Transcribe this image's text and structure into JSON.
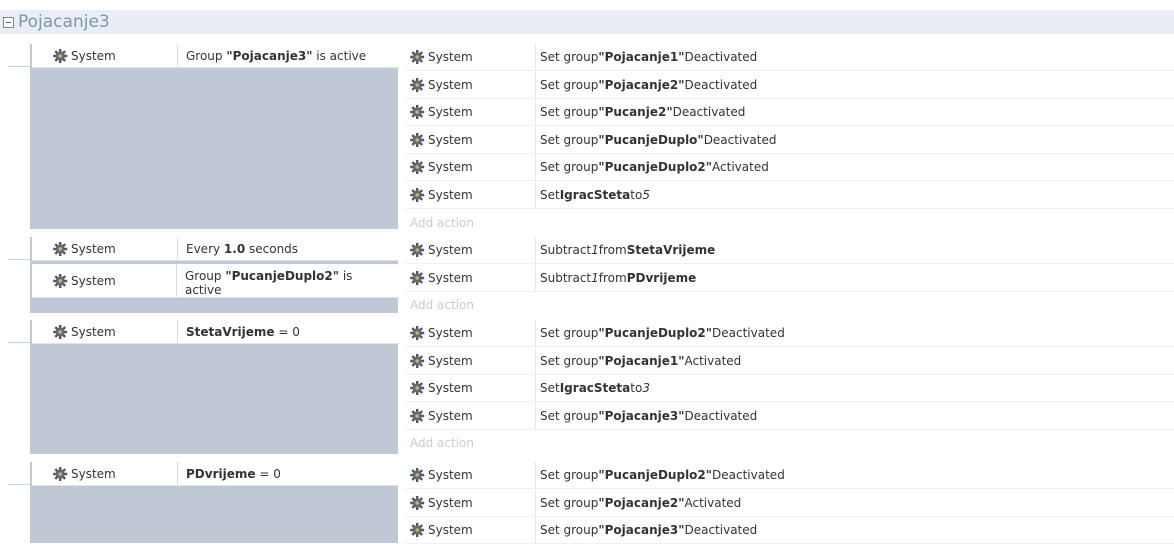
{
  "group": {
    "title": "Pojacanje3"
  },
  "events": [
    {
      "conditions": [
        {
          "object": "System",
          "parts": [
            [
              "t",
              "Group "
            ],
            [
              "b",
              "\"Pojacanje3\""
            ],
            [
              "t",
              " is active"
            ]
          ]
        }
      ],
      "actions": [
        {
          "object": "System",
          "parts": [
            [
              "t",
              "Set group "
            ],
            [
              "b",
              "\"Pojacanje1\""
            ],
            [
              "t",
              " Deactivated"
            ]
          ]
        },
        {
          "object": "System",
          "parts": [
            [
              "t",
              "Set group "
            ],
            [
              "b",
              "\"Pojacanje2\""
            ],
            [
              "t",
              " Deactivated"
            ]
          ]
        },
        {
          "object": "System",
          "parts": [
            [
              "t",
              "Set group "
            ],
            [
              "b",
              "\"Pucanje2\""
            ],
            [
              "t",
              " Deactivated"
            ]
          ]
        },
        {
          "object": "System",
          "parts": [
            [
              "t",
              "Set group "
            ],
            [
              "b",
              "\"PucanjeDuplo\""
            ],
            [
              "t",
              " Deactivated"
            ]
          ]
        },
        {
          "object": "System",
          "parts": [
            [
              "t",
              "Set group "
            ],
            [
              "b",
              "\"PucanjeDuplo2\""
            ],
            [
              "t",
              " Activated"
            ]
          ]
        },
        {
          "object": "System",
          "parts": [
            [
              "t",
              "Set "
            ],
            [
              "b",
              "IgracSteta"
            ],
            [
              "t",
              " to "
            ],
            [
              "i",
              "5"
            ]
          ]
        }
      ],
      "add_action": "Add action"
    },
    {
      "conditions": [
        {
          "object": "System",
          "parts": [
            [
              "t",
              "Every "
            ],
            [
              "b",
              "1.0"
            ],
            [
              "t",
              " seconds"
            ]
          ]
        },
        {
          "object": "System",
          "parts": [
            [
              "t",
              "Group "
            ],
            [
              "b",
              "\"PucanjeDuplo2\""
            ],
            [
              "t",
              " is active"
            ]
          ]
        }
      ],
      "actions": [
        {
          "object": "System",
          "parts": [
            [
              "t",
              "Subtract "
            ],
            [
              "i",
              "1"
            ],
            [
              "t",
              " from "
            ],
            [
              "b",
              "StetaVrijeme"
            ]
          ]
        },
        {
          "object": "System",
          "parts": [
            [
              "t",
              "Subtract "
            ],
            [
              "i",
              "1"
            ],
            [
              "t",
              " from "
            ],
            [
              "b",
              "PDvrijeme"
            ]
          ]
        }
      ],
      "add_action": "Add action"
    },
    {
      "conditions": [
        {
          "object": "System",
          "parts": [
            [
              "b",
              "StetaVrijeme"
            ],
            [
              "t",
              " = 0"
            ]
          ]
        }
      ],
      "actions": [
        {
          "object": "System",
          "parts": [
            [
              "t",
              "Set group "
            ],
            [
              "b",
              "\"PucanjeDuplo2\""
            ],
            [
              "t",
              " Deactivated"
            ]
          ]
        },
        {
          "object": "System",
          "parts": [
            [
              "t",
              "Set group "
            ],
            [
              "b",
              "\"Pojacanje1\""
            ],
            [
              "t",
              " Activated"
            ]
          ]
        },
        {
          "object": "System",
          "parts": [
            [
              "t",
              "Set "
            ],
            [
              "b",
              "IgracSteta"
            ],
            [
              "t",
              " to "
            ],
            [
              "i",
              "3"
            ]
          ]
        },
        {
          "object": "System",
          "parts": [
            [
              "t",
              "Set group "
            ],
            [
              "b",
              "\"Pojacanje3\""
            ],
            [
              "t",
              " Deactivated"
            ]
          ]
        }
      ],
      "add_action": "Add action"
    },
    {
      "conditions": [
        {
          "object": "System",
          "parts": [
            [
              "b",
              "PDvrijeme"
            ],
            [
              "t",
              " = 0"
            ]
          ]
        }
      ],
      "actions": [
        {
          "object": "System",
          "parts": [
            [
              "t",
              "Set group "
            ],
            [
              "b",
              "\"PucanjeDuplo2\""
            ],
            [
              "t",
              " Deactivated"
            ]
          ]
        },
        {
          "object": "System",
          "parts": [
            [
              "t",
              "Set group "
            ],
            [
              "b",
              "\"Pojacanje2\""
            ],
            [
              "t",
              " Activated"
            ]
          ]
        },
        {
          "object": "System",
          "parts": [
            [
              "t",
              "Set group "
            ],
            [
              "b",
              "\"Pojacanje3\""
            ],
            [
              "t",
              " Deactivated"
            ]
          ]
        }
      ],
      "add_action": ""
    }
  ],
  "icons": {
    "object_icon": "gear-icon"
  },
  "colors": {
    "group_bar": "#e8eef4",
    "group_title": "#7d96ad",
    "condition_panel": "#c0c8d5",
    "add_action_text": "#c6cdd6"
  }
}
